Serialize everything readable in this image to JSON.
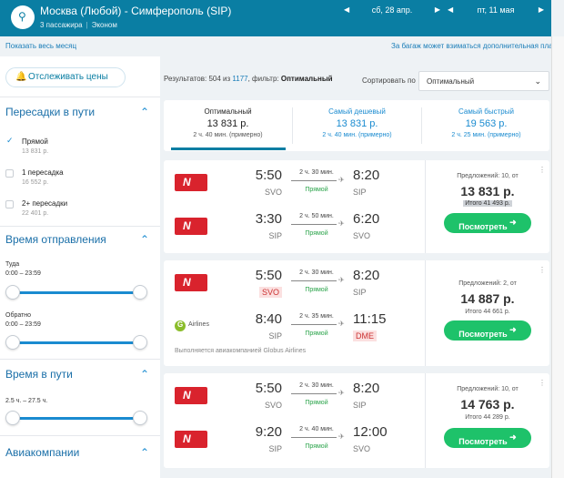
{
  "header": {
    "route": "Москва (Любой) - Симферополь (SIP)",
    "passengers": "3 пассажира",
    "cabin": "Эконом",
    "date_depart": "сб, 28 апр.",
    "date_return": "пт, 11 мая"
  },
  "info": {
    "show_month": "Показать весь месяц",
    "baggage_note": "За багаж может взиматься дополнительная плата"
  },
  "sidebar": {
    "track_prices": "Отслеживать цены",
    "stops": {
      "title": "Пересадки в пути",
      "options": [
        {
          "name": "Прямой",
          "price": "13 831 р.",
          "checked": true
        },
        {
          "name": "1 пересадка",
          "price": "16 552 р.",
          "checked": false
        },
        {
          "name": "2+ пересадки",
          "price": "22 401 р.",
          "checked": false
        }
      ]
    },
    "departure_time": {
      "title": "Время отправления",
      "there_label": "Туда",
      "there_range": "0:00 – 23:59",
      "back_label": "Обратно",
      "back_range": "0:00 – 23:59"
    },
    "travel_time": {
      "title": "Время в пути",
      "range": "2.5 ч. – 27.5 ч."
    },
    "airlines": {
      "title": "Авиакомпании"
    }
  },
  "results": {
    "prefix": "Результатов: ",
    "shown": "504",
    "of": " из ",
    "total": "1177",
    "filter_label": ", фильтр: ",
    "filter_value": "Оптимальный",
    "sort_label": "Сортировать по",
    "sort_value": "Оптимальный"
  },
  "tabs": [
    {
      "title": "Оптимальный",
      "price": "13 831 р.",
      "duration": "2 ч. 40 мин. (примерно)"
    },
    {
      "title": "Самый дешевый",
      "price": "13 831 р.",
      "duration": "2 ч. 40 мин. (примерно)"
    },
    {
      "title": "Самый быстрый",
      "price": "19 563 р.",
      "duration": "2 ч. 25 мин. (примерно)"
    }
  ],
  "cards": [
    {
      "legs": [
        {
          "airline": "nordwind",
          "dep_time": "5:50",
          "dep_code": "SVO",
          "duration": "2 ч. 30 мин.",
          "stops": "Прямой",
          "arr_time": "8:20",
          "arr_code": "SIP"
        },
        {
          "airline": "nordwind",
          "dep_time": "3:30",
          "dep_code": "SIP",
          "duration": "2 ч. 50 мин.",
          "stops": "Прямой",
          "arr_time": "6:20",
          "arr_code": "SVO"
        }
      ],
      "offers": "Предложений: 10, от",
      "price": "13 831 р.",
      "total": "Итого 41 493 р.",
      "button": "Посмотреть"
    },
    {
      "legs": [
        {
          "airline": "nordwind",
          "dep_time": "5:50",
          "dep_code": "SVO",
          "duration": "2 ч. 30 мин.",
          "stops": "Прямой",
          "arr_time": "8:20",
          "arr_code": "SIP"
        },
        {
          "airline": "globus",
          "airline_name": "Airlines",
          "dep_time": "8:40",
          "dep_code": "SIP",
          "duration": "2 ч. 35 мин.",
          "stops": "Прямой",
          "arr_time": "11:15",
          "arr_code": "DME"
        }
      ],
      "operated": "Выполняется авиакомпанией Globus Airlines",
      "offers": "Предложений: 2, от",
      "price": "14 887 р.",
      "total": "Итого 44 661 р.",
      "button": "Посмотреть"
    },
    {
      "legs": [
        {
          "airline": "nordwind",
          "dep_time": "5:50",
          "dep_code": "SVO",
          "duration": "2 ч. 30 мин.",
          "stops": "Прямой",
          "arr_time": "8:20",
          "arr_code": "SIP"
        },
        {
          "airline": "nordwind",
          "dep_time": "9:20",
          "dep_code": "SIP",
          "duration": "2 ч. 40 мин.",
          "stops": "Прямой",
          "arr_time": "12:00",
          "arr_code": "SVO"
        }
      ],
      "offers": "Предложений: 10, от",
      "price": "14 763 р.",
      "total": "Итого 44 289 р.",
      "button": "Посмотреть"
    }
  ],
  "colors": {
    "header": "#0a7ea3",
    "accent": "#1a8bd0",
    "cta": "#1ec26a",
    "nordwind": "#d9232d"
  }
}
